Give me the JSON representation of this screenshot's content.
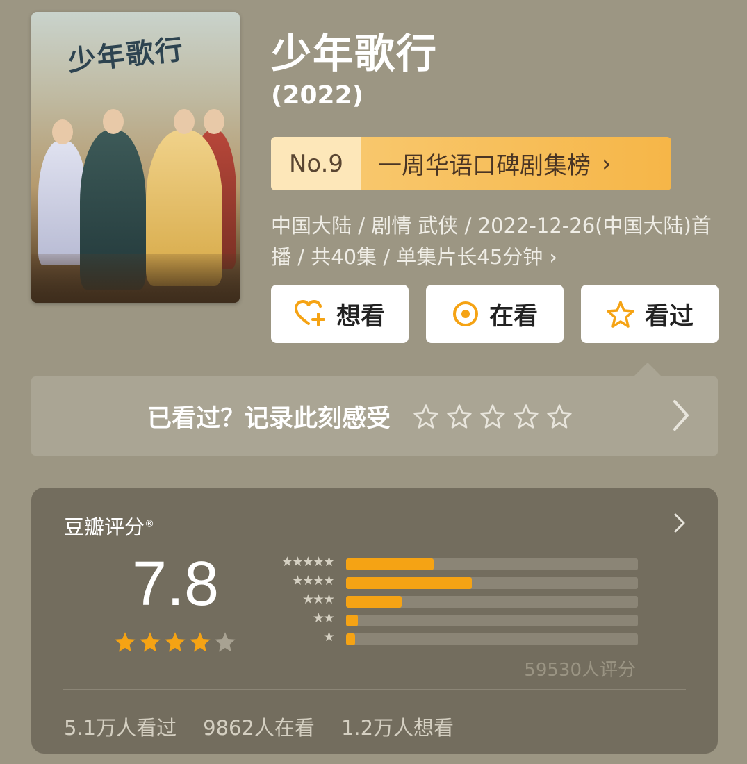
{
  "poster": {
    "calligraphy": "少年歌行"
  },
  "title": "少年歌行",
  "year": "(2022)",
  "rank": {
    "no": "No.9",
    "list": "一周华语口碑剧集榜",
    "arrow": "›"
  },
  "meta": "中国大陆 / 剧情 武侠 / 2022-12-26(中国大陆)首播 / 共40集 / 单集片长45分钟 ›",
  "actions": [
    {
      "label": "想看",
      "icon": "heart-plus-icon"
    },
    {
      "label": "在看",
      "icon": "target-icon"
    },
    {
      "label": "看过",
      "icon": "star-icon"
    }
  ],
  "record": {
    "text": "已看过？记录此刻感受"
  },
  "rating": {
    "label": "豆瓣评分",
    "mark": "®",
    "score": "7.8",
    "stars_filled": 4,
    "stars_total": 5,
    "distribution": [
      {
        "stars": "★★★★★",
        "fraction": 0.3
      },
      {
        "stars": "★★★★",
        "fraction": 0.43
      },
      {
        "stars": "★★★",
        "fraction": 0.19
      },
      {
        "stars": "★★",
        "fraction": 0.04
      },
      {
        "stars": "★",
        "fraction": 0.03
      }
    ],
    "count": "59530人评分",
    "stats": {
      "watched": "5.1万人看过",
      "watching": "9862人在看",
      "want": "1.2万人想看"
    }
  },
  "colors": {
    "accent": "#f5a314",
    "background": "#9c9683",
    "card": "#736d5e"
  }
}
